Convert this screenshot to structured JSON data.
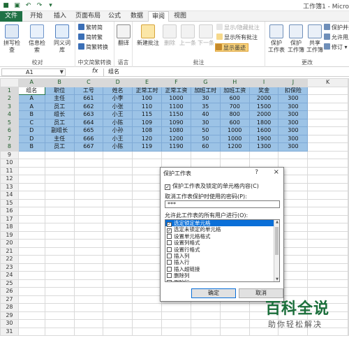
{
  "window": {
    "title": "工作簿1 - Micro"
  },
  "tabs": [
    "文件",
    "开始",
    "插入",
    "页面布局",
    "公式",
    "数据",
    "审阅",
    "视图"
  ],
  "active_tab": "审阅",
  "ribbon": {
    "proofing": {
      "label": "校对",
      "spell": "拼写检查",
      "research": "信息检索",
      "thesaurus": "同义词库"
    },
    "chinese": {
      "label": "中文简繁转换",
      "to_trad": "繁转简",
      "to_simp": "简转繁",
      "convert": "简繁转换"
    },
    "language": {
      "label": "语言",
      "translate": "翻译"
    },
    "comments": {
      "label": "批注",
      "new": "新建批注",
      "delete": "删除",
      "prev": "上一条",
      "next": "下一条",
      "show_hide": "显示/隐藏批注",
      "show_all": "显示所有批注",
      "show_ink": "显示墨迹"
    },
    "changes": {
      "label": "更改",
      "protect_sheet_1": "保护",
      "protect_sheet_2": "工作表",
      "protect_wb_1": "保护",
      "protect_wb_2": "工作簿",
      "share_1": "共享",
      "share_2": "工作簿",
      "protect_share": "保护并共",
      "allow_edit": "允许用户",
      "track": "修订 ▾"
    }
  },
  "formula_bar": {
    "name_box": "A1",
    "fx": "fx",
    "content": "组名"
  },
  "sheet": {
    "columns": [
      "A",
      "B",
      "C",
      "D",
      "E",
      "F",
      "G",
      "H",
      "I",
      "J",
      "K"
    ],
    "header": [
      "组名",
      "职位",
      "工号",
      "姓名",
      "正常工时",
      "正常工资",
      "加班工时",
      "加班工资",
      "奖金",
      "扣保险"
    ],
    "rows": [
      [
        "A",
        "主任",
        "661",
        "小李",
        "100",
        "1000",
        "30",
        "600",
        "2000",
        "300"
      ],
      [
        "A",
        "员工",
        "662",
        "小张",
        "110",
        "1100",
        "35",
        "700",
        "1500",
        "300"
      ],
      [
        "B",
        "组长",
        "663",
        "小王",
        "115",
        "1150",
        "40",
        "800",
        "2000",
        "300"
      ],
      [
        "C",
        "员工",
        "664",
        "小陈",
        "109",
        "1090",
        "30",
        "600",
        "1800",
        "300"
      ],
      [
        "D",
        "副组长",
        "665",
        "小孙",
        "108",
        "1080",
        "50",
        "1000",
        "1600",
        "300"
      ],
      [
        "D",
        "主任",
        "666",
        "小王",
        "120",
        "1200",
        "50",
        "1000",
        "1900",
        "300"
      ],
      [
        "B",
        "员工",
        "667",
        "小陈",
        "119",
        "1190",
        "60",
        "1200",
        "1300",
        "300"
      ]
    ],
    "total_rows": 31
  },
  "dialog": {
    "title": "保护工作表",
    "help": "?",
    "close": "×",
    "protect_checkbox": "保护工作表及锁定的单元格内容(C)",
    "protect_checked": true,
    "password_label": "取消工作表保护时使用的密码(P):",
    "password_value": "***",
    "allow_label": "允许此工作表的所有用户进行(O):",
    "permissions": [
      {
        "label": "选定锁定单元格",
        "checked": true,
        "selected": true
      },
      {
        "label": "选定未锁定的单元格",
        "checked": true,
        "selected": false
      },
      {
        "label": "设置单元格格式",
        "checked": false,
        "selected": false
      },
      {
        "label": "设置列格式",
        "checked": false,
        "selected": false
      },
      {
        "label": "设置行格式",
        "checked": false,
        "selected": false
      },
      {
        "label": "插入列",
        "checked": false,
        "selected": false
      },
      {
        "label": "插入行",
        "checked": false,
        "selected": false
      },
      {
        "label": "插入超链接",
        "checked": false,
        "selected": false
      },
      {
        "label": "删除列",
        "checked": false,
        "selected": false
      },
      {
        "label": "删除行",
        "checked": false,
        "selected": false
      }
    ],
    "ok": "确定",
    "cancel": "取消"
  },
  "watermark": {
    "main": "百科全说",
    "sub": "助你轻松解决"
  },
  "colors": {
    "excel_green": "#1f7145",
    "selection_blue": "#9cc3e6",
    "ok_border": "#0a6fd8",
    "highlight": "#f9d27a"
  }
}
